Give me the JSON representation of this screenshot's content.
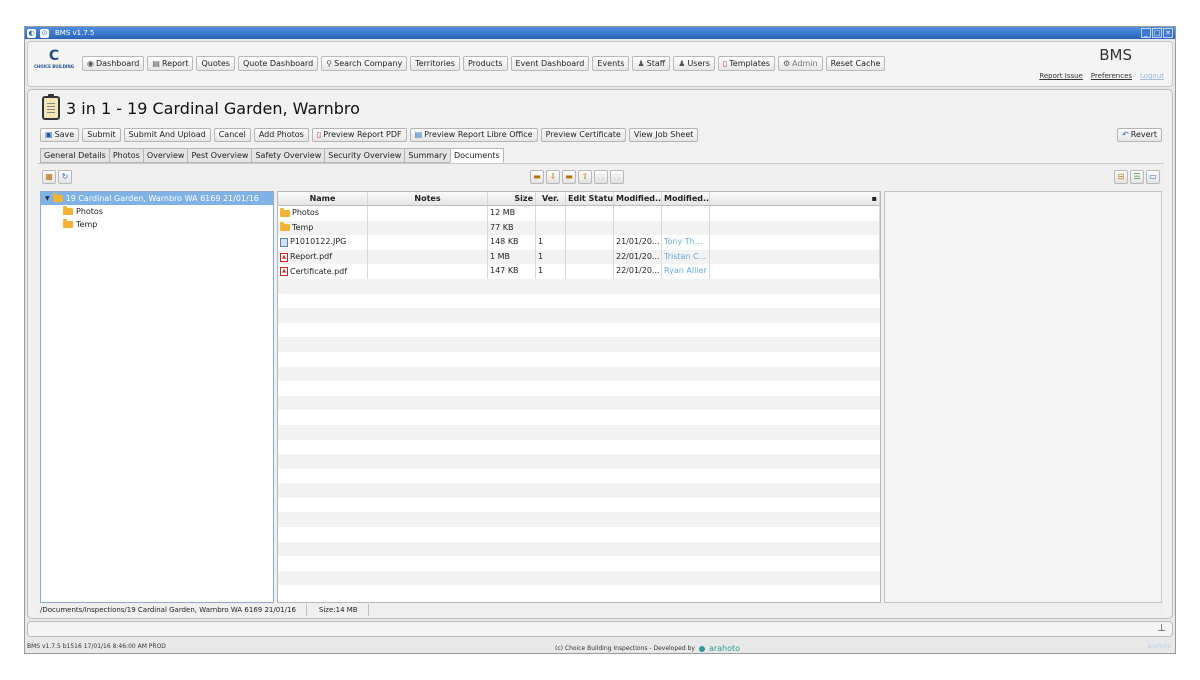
{
  "app": {
    "title": "BMS v1.7.5",
    "brand": "BMS",
    "logo_text": "CHOICE BUILDING"
  },
  "nav": {
    "items": [
      {
        "label": "Dashboard",
        "icon": "dashboard-icon"
      },
      {
        "label": "Report",
        "icon": "report-icon"
      },
      {
        "label": "Quotes"
      },
      {
        "label": "Quote Dashboard"
      },
      {
        "label": "Search Company",
        "icon": "search-icon"
      },
      {
        "label": "Territories"
      },
      {
        "label": "Products"
      },
      {
        "label": "Event Dashboard"
      },
      {
        "label": "Events"
      },
      {
        "label": "Staff",
        "icon": "staff-icon"
      },
      {
        "label": "Users",
        "icon": "users-icon"
      },
      {
        "label": "Templates",
        "icon": "templates-icon"
      },
      {
        "label": "Admin",
        "icon": "admin-icon"
      },
      {
        "label": "Reset Cache"
      }
    ],
    "links": {
      "report_issue": "Report Issue",
      "preferences": "Preferences",
      "logout": "Logout"
    }
  },
  "page": {
    "title": "3 in 1 - 19 Cardinal Garden, Warnbro"
  },
  "actions": {
    "save": "Save",
    "submit": "Submit",
    "submit_upload": "Submit And Upload",
    "cancel": "Cancel",
    "add_photos": "Add Photos",
    "preview_pdf": "Preview Report PDF",
    "preview_libre": "Preview Report Libre Office",
    "preview_cert": "Preview Certificate",
    "view_job": "View Job Sheet",
    "revert": "Revert"
  },
  "tabs": [
    "General Details",
    "Photos",
    "Overview",
    "Pest Overview",
    "Safety Overview",
    "Security Overview",
    "Summary",
    "Documents"
  ],
  "tree": {
    "root": "19 Cardinal Garden, Warnbro WA 6169 21/01/16",
    "children": [
      "Photos",
      "Temp"
    ]
  },
  "grid": {
    "headers": [
      "Name",
      "Notes",
      "Size",
      "Ver.",
      "Edit Status",
      "Modified...",
      "Modified..."
    ],
    "rows": [
      {
        "name": "Photos",
        "type": "folder",
        "notes": "",
        "size": "12 MB",
        "ver": "",
        "status": "",
        "date": "",
        "by": ""
      },
      {
        "name": "Temp",
        "type": "folder",
        "notes": "",
        "size": "77 KB",
        "ver": "",
        "status": "",
        "date": "",
        "by": ""
      },
      {
        "name": "P1010122.JPG",
        "type": "jpg",
        "notes": "",
        "size": "148 KB",
        "ver": "1",
        "status": "",
        "date": "21/01/20...",
        "by": "Tony Th..."
      },
      {
        "name": "Report.pdf",
        "type": "pdf",
        "notes": "",
        "size": "1 MB",
        "ver": "1",
        "status": "",
        "date": "22/01/20...",
        "by": "Tristan C..."
      },
      {
        "name": "Certificate.pdf",
        "type": "pdf",
        "notes": "",
        "size": "147 KB",
        "ver": "1",
        "status": "",
        "date": "22/01/20...",
        "by": "Ryan Allier"
      }
    ]
  },
  "status": {
    "path": "/Documents/Inspections/19 Cardinal Garden, Warnbro WA 6169 21/01/16",
    "size": "Size:14 MB"
  },
  "footer": {
    "version": "BMS v1.7.5 b1516 17/01/16 8:46:00 AM PROD",
    "copyright": "(c)  Choice Building Inspections  - Developed by",
    "developer": "arahoto",
    "right": "arahoto"
  }
}
